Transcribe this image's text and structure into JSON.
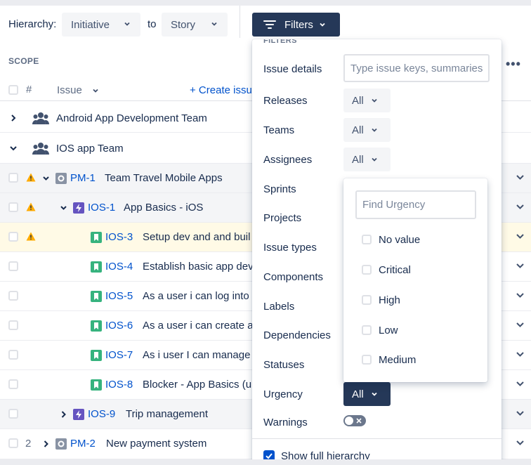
{
  "toolbar": {
    "hierarchy_label": "Hierarchy:",
    "from_value": "Initiative",
    "to_label": "to",
    "to_value": "Story",
    "filters_label": "Filters"
  },
  "scope_label": "SCOPE",
  "header": {
    "hash": "#",
    "issue": "Issue",
    "create_issue": "+ Create issu"
  },
  "teams": [
    "Android App Development Team",
    "IOS app Team"
  ],
  "rows": [
    {
      "num": "",
      "key": "PM-1",
      "title": "Team Travel Mobile Apps",
      "type": "initiative",
      "warning": true
    },
    {
      "num": "",
      "key": "IOS-1",
      "title": "App Basics - iOS",
      "type": "epic",
      "warning": true
    },
    {
      "num": "",
      "key": "IOS-3",
      "title": "Setup dev and and buil",
      "type": "story",
      "warning": true
    },
    {
      "num": "",
      "key": "IOS-4",
      "title": "Establish basic app dev",
      "type": "story",
      "warning": false
    },
    {
      "num": "",
      "key": "IOS-5",
      "title": "As a user i can log into",
      "type": "story",
      "warning": false
    },
    {
      "num": "",
      "key": "IOS-6",
      "title": "As a user i can create a",
      "type": "story",
      "warning": false
    },
    {
      "num": "",
      "key": "IOS-7",
      "title": "As i user I can manage",
      "type": "story",
      "warning": false
    },
    {
      "num": "",
      "key": "IOS-8",
      "title": "Blocker - App Basics (u",
      "type": "story",
      "warning": false
    },
    {
      "num": "",
      "key": "IOS-9",
      "title": "Trip management",
      "type": "epic",
      "warning": false
    },
    {
      "num": "2",
      "key": "PM-2",
      "title": "New payment system",
      "type": "initiative",
      "warning": false
    }
  ],
  "filters_panel": {
    "title": "FILTERS",
    "issue_details_label": "Issue details",
    "issue_details_placeholder": "Type issue keys, summaries",
    "releases_label": "Releases",
    "teams_label": "Teams",
    "assignees_label": "Assignees",
    "sprints_label": "Sprints",
    "projects_label": "Projects",
    "issue_types_label": "Issue types",
    "components_label": "Components",
    "labels_label": "Labels",
    "dependencies_label": "Dependencies",
    "statuses_label": "Statuses",
    "urgency_label": "Urgency",
    "warnings_label": "Warnings",
    "all_value": "All",
    "show_full_hierarchy": "Show full hierarchy"
  },
  "urgency_dropdown": {
    "placeholder": "Find Urgency",
    "options": [
      "No value",
      "Critical",
      "High",
      "Low",
      "Medium"
    ]
  },
  "colors": {
    "primary_dark": "#253858",
    "link": "#0052cc",
    "story": "#36b37e",
    "epic": "#6554c0",
    "warning": "#ffab00",
    "highlight_row": "#fffae6"
  }
}
